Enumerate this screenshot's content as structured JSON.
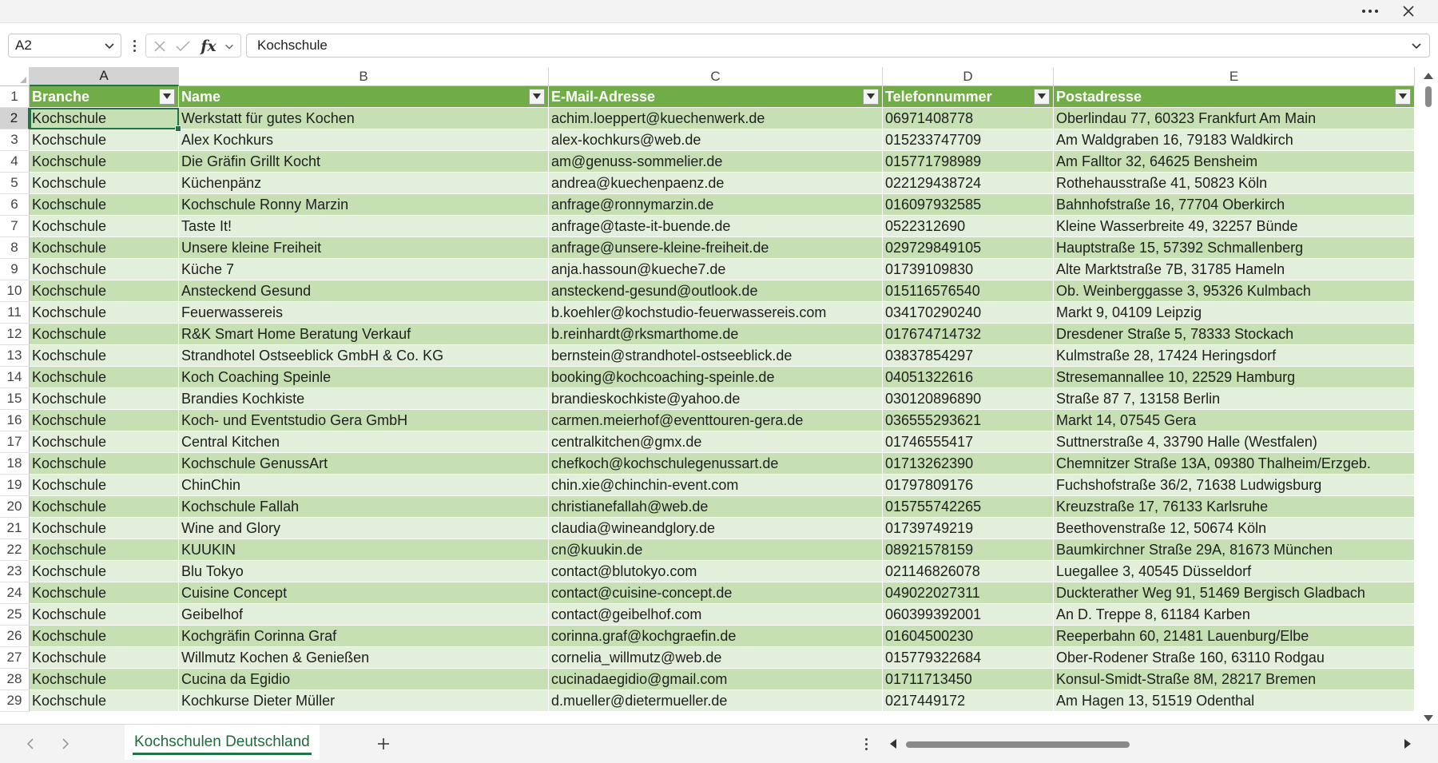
{
  "window": {
    "more_label": "•••"
  },
  "formula_bar": {
    "name_box": "A2",
    "fx_label": "fx",
    "content": "Kochschule"
  },
  "columns": [
    "A",
    "B",
    "C",
    "D",
    "E"
  ],
  "selected_column": "A",
  "selected_row": "2",
  "table": {
    "header_row_number": "1",
    "headers": [
      "Branche",
      "Name",
      "E-Mail-Adresse",
      "Telefonnummer",
      "Postadresse"
    ],
    "rows": [
      {
        "n": "2",
        "cells": [
          "Kochschule",
          "Werkstatt für gutes Kochen",
          "achim.loeppert@kuechenwerk.de",
          "06971408778",
          "Oberlindau 77, 60323 Frankfurt Am Main"
        ]
      },
      {
        "n": "3",
        "cells": [
          "Kochschule",
          "Alex Kochkurs",
          "alex-kochkurs@web.de",
          "015233747709",
          "Am Waldgraben 16, 79183 Waldkirch"
        ]
      },
      {
        "n": "4",
        "cells": [
          "Kochschule",
          "Die Gräfin Grillt Kocht",
          "am@genuss-sommelier.de",
          "015771798989",
          "Am Falltor 32, 64625 Bensheim"
        ]
      },
      {
        "n": "5",
        "cells": [
          "Kochschule",
          "Küchenpänz",
          "andrea@kuechenpaenz.de",
          "022129438724",
          "Rothehausstraße 41, 50823 Köln"
        ]
      },
      {
        "n": "6",
        "cells": [
          "Kochschule",
          "Kochschule Ronny Marzin",
          "anfrage@ronnymarzin.de",
          "016097932585",
          "Bahnhofstraße 16, 77704 Oberkirch"
        ]
      },
      {
        "n": "7",
        "cells": [
          "Kochschule",
          "Taste It!",
          "anfrage@taste-it-buende.de",
          "0522312690",
          "Kleine Wasserbreite 49, 32257 Bünde"
        ]
      },
      {
        "n": "8",
        "cells": [
          "Kochschule",
          "Unsere kleine Freiheit",
          "anfrage@unsere-kleine-freiheit.de",
          "029729849105",
          "Hauptstraße 15, 57392 Schmallenberg"
        ]
      },
      {
        "n": "9",
        "cells": [
          "Kochschule",
          "Küche 7",
          "anja.hassoun@kueche7.de",
          "01739109830",
          "Alte Marktstraße 7B, 31785 Hameln"
        ]
      },
      {
        "n": "10",
        "cells": [
          "Kochschule",
          "Ansteckend Gesund",
          "ansteckend-gesund@outlook.de",
          "015116576540",
          "Ob. Weinberggasse 3, 95326 Kulmbach"
        ]
      },
      {
        "n": "11",
        "cells": [
          "Kochschule",
          "Feuerwassereis",
          "b.koehler@kochstudio-feuerwassereis.com",
          "034170290240",
          "Markt 9, 04109 Leipzig"
        ]
      },
      {
        "n": "12",
        "cells": [
          "Kochschule",
          "R&K Smart Home Beratung Verkauf",
          "b.reinhardt@rksmarthome.de",
          "017674714732",
          "Dresdener Straße 5, 78333 Stockach"
        ]
      },
      {
        "n": "13",
        "cells": [
          "Kochschule",
          "Strandhotel Ostseeblick GmbH & Co. KG",
          "bernstein@strandhotel-ostseeblick.de",
          "03837854297",
          "Kulmstraße 28, 17424 Heringsdorf"
        ]
      },
      {
        "n": "14",
        "cells": [
          "Kochschule",
          "Koch Coaching Speinle",
          "booking@kochcoaching-speinle.de",
          "04051322616",
          "Stresemannallee 10, 22529 Hamburg"
        ]
      },
      {
        "n": "15",
        "cells": [
          "Kochschule",
          "Brandies Kochkiste",
          "brandieskochkiste@yahoo.de",
          "030120896890",
          "Straße 87 7, 13158 Berlin"
        ]
      },
      {
        "n": "16",
        "cells": [
          "Kochschule",
          "Koch- und Eventstudio Gera GmbH",
          "carmen.meierhof@eventtouren-gera.de",
          "036555293621",
          "Markt 14, 07545 Gera"
        ]
      },
      {
        "n": "17",
        "cells": [
          "Kochschule",
          "Central Kitchen",
          "centralkitchen@gmx.de",
          "01746555417",
          "Suttnerstraße 4, 33790 Halle (Westfalen)"
        ]
      },
      {
        "n": "18",
        "cells": [
          "Kochschule",
          "Kochschule GenussArt",
          "chefkoch@kochschulegenussart.de",
          "01713262390",
          "Chemnitzer Straße 13A, 09380 Thalheim/Erzgeb."
        ]
      },
      {
        "n": "19",
        "cells": [
          "Kochschule",
          "ChinChin",
          "chin.xie@chinchin-event.com",
          "01797809176",
          "Fuchshofstraße 36/2, 71638 Ludwigsburg"
        ]
      },
      {
        "n": "20",
        "cells": [
          "Kochschule",
          "Kochschule Fallah",
          "christianefallah@web.de",
          "015755742265",
          "Kreuzstraße 17, 76133 Karlsruhe"
        ]
      },
      {
        "n": "21",
        "cells": [
          "Kochschule",
          "Wine and Glory",
          "claudia@wineandglory.de",
          "01739749219",
          "Beethovenstraße 12, 50674 Köln"
        ]
      },
      {
        "n": "22",
        "cells": [
          "Kochschule",
          "KUUKIN",
          "cn@kuukin.de",
          "08921578159",
          "Baumkirchner Straße 29A, 81673 München"
        ]
      },
      {
        "n": "23",
        "cells": [
          "Kochschule",
          "Blu Tokyo",
          "contact@blutokyo.com",
          "021146826078",
          "Luegallee 3, 40545 Düsseldorf"
        ]
      },
      {
        "n": "24",
        "cells": [
          "Kochschule",
          "Cuisine Concept",
          "contact@cuisine-concept.de",
          "049022027311",
          "Duckterather Weg 91, 51469 Bergisch Gladbach"
        ]
      },
      {
        "n": "25",
        "cells": [
          "Kochschule",
          "Geibelhof",
          "contact@geibelhof.com",
          "060399392001",
          "An D. Treppe 8, 61184 Karben"
        ]
      },
      {
        "n": "26",
        "cells": [
          "Kochschule",
          "Kochgräfin Corinna Graf",
          "corinna.graf@kochgraefin.de",
          "01604500230",
          "Reeperbahn 60, 21481 Lauenburg/Elbe"
        ]
      },
      {
        "n": "27",
        "cells": [
          "Kochschule",
          "Willmutz Kochen & Genießen",
          "cornelia_willmutz@web.de",
          "015779322684",
          "Ober-Rodener Straße 160, 63110 Rodgau"
        ]
      },
      {
        "n": "28",
        "cells": [
          "Kochschule",
          "Cucina da Egidio",
          "cucinadaegidio@gmail.com",
          "01711713450",
          "Konsul-Smidt-Straße 8M, 28217 Bremen"
        ]
      },
      {
        "n": "29",
        "cells": [
          "Kochschule",
          "Kochkurse Dieter Müller",
          "d.mueller@dietermueller.de",
          "0217449172",
          "Am Hagen 13, 51519 Odenthal"
        ]
      }
    ]
  },
  "sheet_tabs": [
    {
      "label": "Kochschulen Deutschland",
      "active": true
    }
  ],
  "colors": {
    "header_fill": "#70ad47",
    "band_dark": "#c6e0b4",
    "band_light": "#e2efda",
    "accent": "#217346"
  }
}
